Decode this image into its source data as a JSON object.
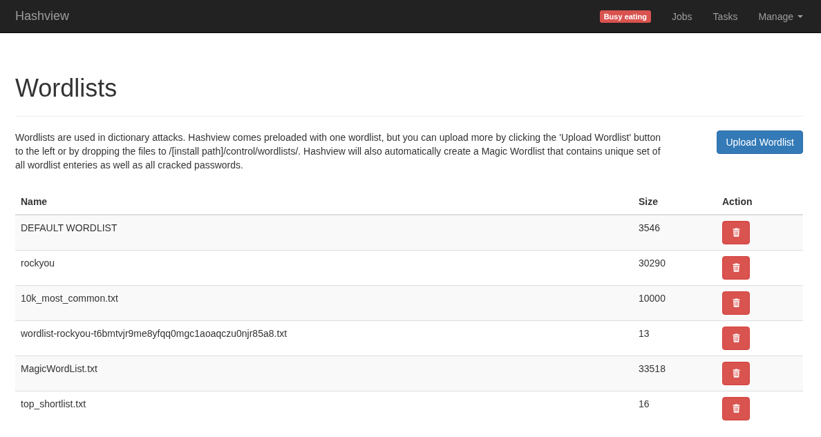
{
  "navbar": {
    "brand": "Hashview",
    "badge": "Busy eating",
    "links": [
      {
        "label": "Jobs",
        "dropdown": false
      },
      {
        "label": "Tasks",
        "dropdown": false
      },
      {
        "label": "Manage",
        "dropdown": true
      }
    ]
  },
  "page": {
    "title": "Wordlists",
    "description": "Wordlists are used in dictionary attacks. Hashview comes preloaded with one wordlist, but you can upload more by clicking the 'Upload Wordlist' button to the left or by dropping the files to /[install path]/control/wordlists/. Hashview will also automatically create a Magic Wordlist that contains unique set of all wordlist enteries as well as all cracked passwords.",
    "upload_button": "Upload Wordlist"
  },
  "table": {
    "columns": [
      "Name",
      "Size",
      "Action"
    ],
    "rows": [
      {
        "name": "DEFAULT WORDLIST",
        "size": "3546"
      },
      {
        "name": "rockyou",
        "size": "30290"
      },
      {
        "name": "10k_most_common.txt",
        "size": "10000"
      },
      {
        "name": "wordlist-rockyou-t6bmtvjr9me8yfqq0mgc1aoaqczu0njr85a8.txt",
        "size": "13"
      },
      {
        "name": "MagicWordList.txt",
        "size": "33518"
      },
      {
        "name": "top_shortlist.txt",
        "size": "16"
      }
    ]
  }
}
